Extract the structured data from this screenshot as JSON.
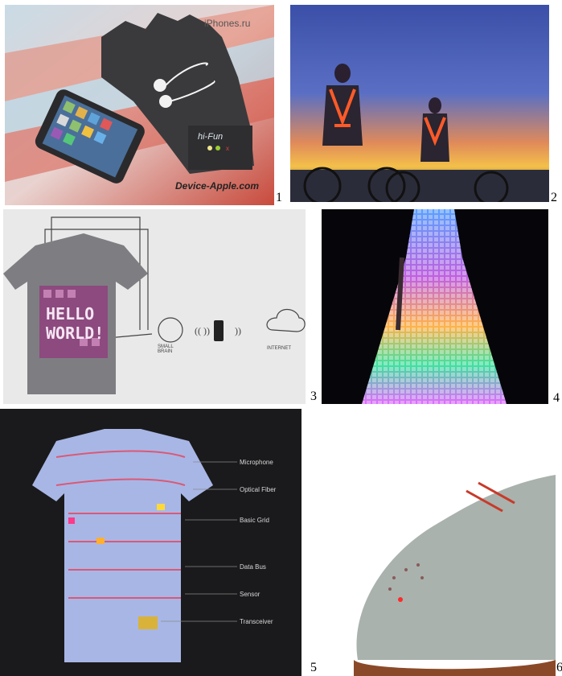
{
  "panels": [
    {
      "number": "1",
      "watermark_top": "iPhones.ru",
      "watermark_bottom": "Device-Apple.com",
      "glove_text": "hi-Fun"
    },
    {
      "number": "2"
    },
    {
      "number": "3",
      "shirt_text_line1": "HELLO",
      "shirt_text_line2": "WORLD!",
      "brain_label": "SMALL BRAIN",
      "cloud_label": "INTERNET"
    },
    {
      "number": "4"
    },
    {
      "number": "5",
      "labels": [
        "Microphone",
        "Optical Fiber",
        "Basic Grid",
        "Data Bus",
        "Sensor",
        "Transceiver"
      ]
    },
    {
      "number": "6"
    }
  ]
}
